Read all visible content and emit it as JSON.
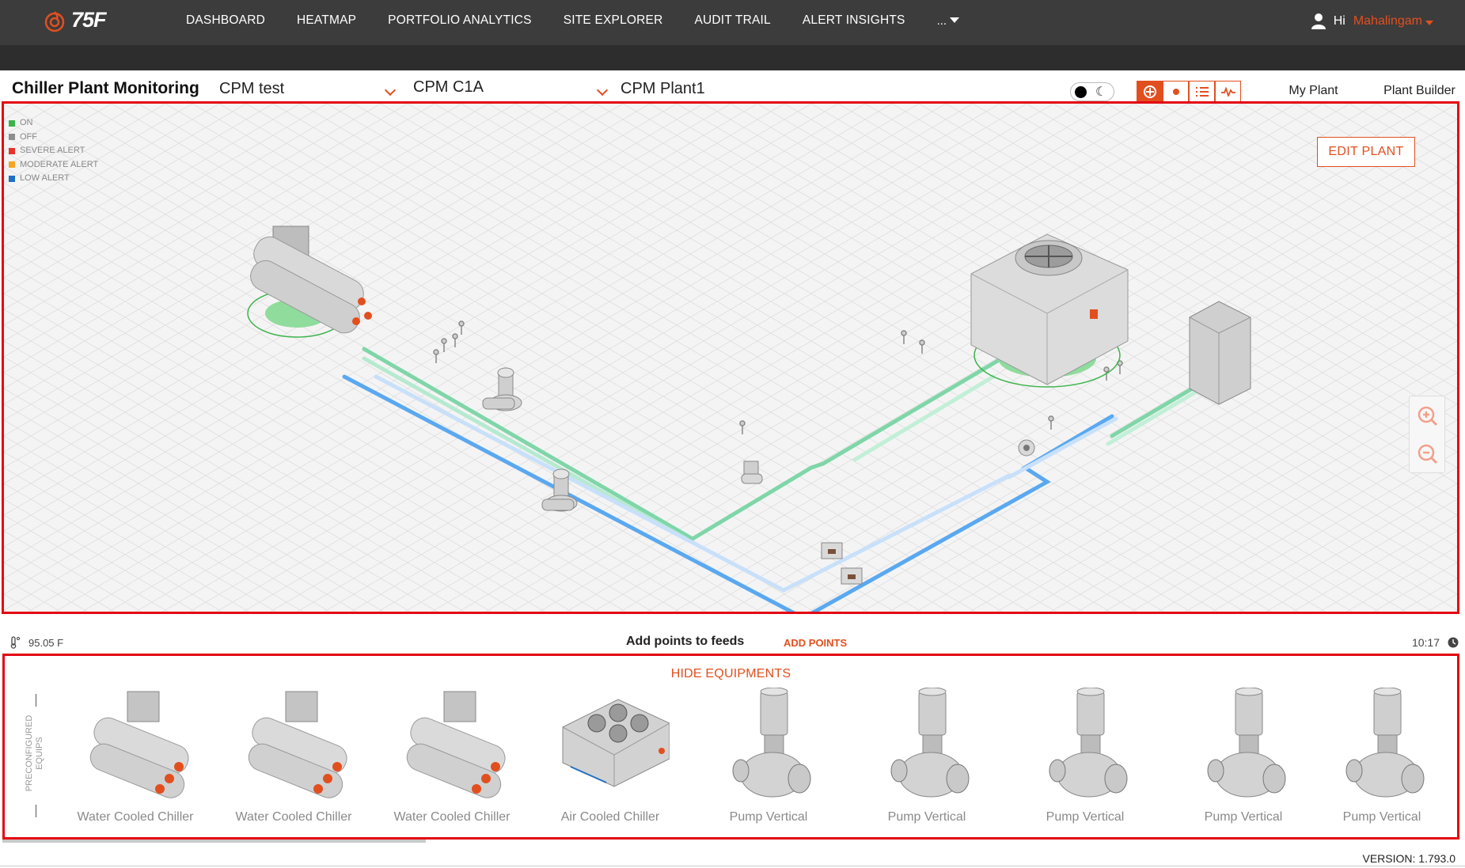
{
  "app": {
    "logo_text": "75F"
  },
  "nav": {
    "items": [
      "DASHBOARD",
      "HEATMAP",
      "PORTFOLIO ANALYTICS",
      "SITE EXPLORER",
      "AUDIT TRAIL",
      "ALERT INSIGHTS"
    ],
    "more_label": "..."
  },
  "user": {
    "greeting": "Hi",
    "name": "Mahalingam"
  },
  "header": {
    "title": "Chiller Plant Monitoring",
    "site_select": "CPM test",
    "building_select": "CPM C1A",
    "plant_select": "CPM Plant1",
    "tabs": [
      "My Plant",
      "Plant Builder"
    ],
    "active_tab": "My Plant"
  },
  "legend": {
    "items": [
      {
        "label": "ON",
        "color": "#3cb44b"
      },
      {
        "label": "OFF",
        "color": "#8e8e8e"
      },
      {
        "label": "SEVERE ALERT",
        "color": "#e8322b"
      },
      {
        "label": "MODERATE ALERT",
        "color": "#f5a623"
      },
      {
        "label": "LOW ALERT",
        "color": "#1f6fc4"
      }
    ]
  },
  "canvas": {
    "edit_button": "EDIT PLANT"
  },
  "status": {
    "temperature": "95.05 F",
    "feeds_text": "Add points to feeds",
    "add_points": "ADD POINTS",
    "time": "10:17"
  },
  "equipments": {
    "hide_label": "HIDE EQUIPMENTS",
    "section_label": "PRECONFIGURED EQUIPS",
    "items": [
      {
        "label": "Water Cooled Chiller",
        "icon": "water-cooled-chiller"
      },
      {
        "label": "Water Cooled Chiller",
        "icon": "water-cooled-chiller"
      },
      {
        "label": "Water Cooled Chiller",
        "icon": "water-cooled-chiller"
      },
      {
        "label": "Air Cooled Chiller",
        "icon": "air-cooled-chiller"
      },
      {
        "label": "Pump Vertical",
        "icon": "pump-vertical"
      },
      {
        "label": "Pump Vertical",
        "icon": "pump-vertical"
      },
      {
        "label": "Pump Vertical",
        "icon": "pump-vertical"
      },
      {
        "label": "Pump Vertical",
        "icon": "pump-vertical"
      },
      {
        "label": "Pump Vertical",
        "icon": "pump-vertical"
      }
    ]
  },
  "footer": {
    "version": "VERSION: 1.793.0"
  },
  "colors": {
    "accent": "#e24f1f",
    "highlight_border": "#e30613",
    "pipe_green": "#7fd6a8",
    "pipe_blue": "#5aa8f0"
  }
}
